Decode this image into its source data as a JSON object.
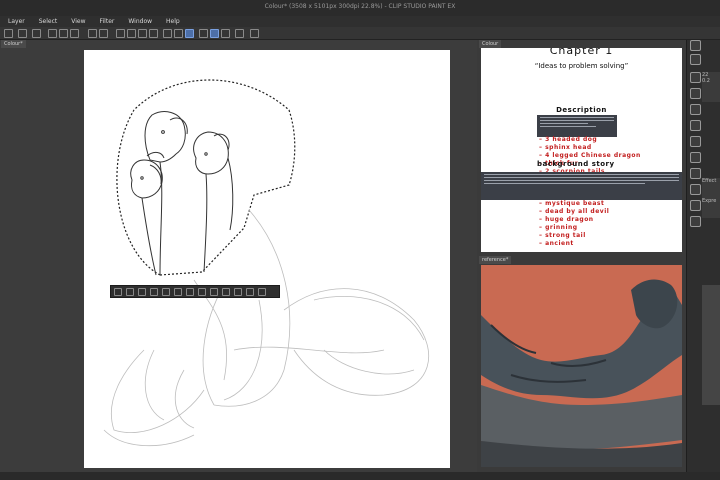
{
  "window": {
    "title": "Colour* (3508 x 5101px 300dpi 22.8%) - CLIP STUDIO PAINT EX"
  },
  "menu": [
    "Layer",
    "Select",
    "View",
    "Filter",
    "Window",
    "Help"
  ],
  "canvas_tab": "Colour*",
  "ref1_tab": "Colour",
  "ref2_tab": "reference*",
  "ref_doc": {
    "chapter": "Chapter 1",
    "subtitle": "“Ideas to problem solving”",
    "description_heading": "Description",
    "description_items": [
      "3 headed dog",
      "sphinx head",
      "4 legged Chinese dragon",
      "thick fur",
      "2 scorpion tails"
    ],
    "background_heading": "background story",
    "background_items": [
      "mystique beast",
      "dead by all devil",
      "huge dragon",
      "grinning",
      "strong tail",
      "ancient"
    ]
  },
  "right_panel": {
    "labels": [
      "22",
      "0.2",
      "Effect",
      "Expre"
    ]
  },
  "colors": {
    "accent": "#4d6fa8",
    "ref_background": "#c96a52",
    "red_ink": "#c21d1d"
  }
}
